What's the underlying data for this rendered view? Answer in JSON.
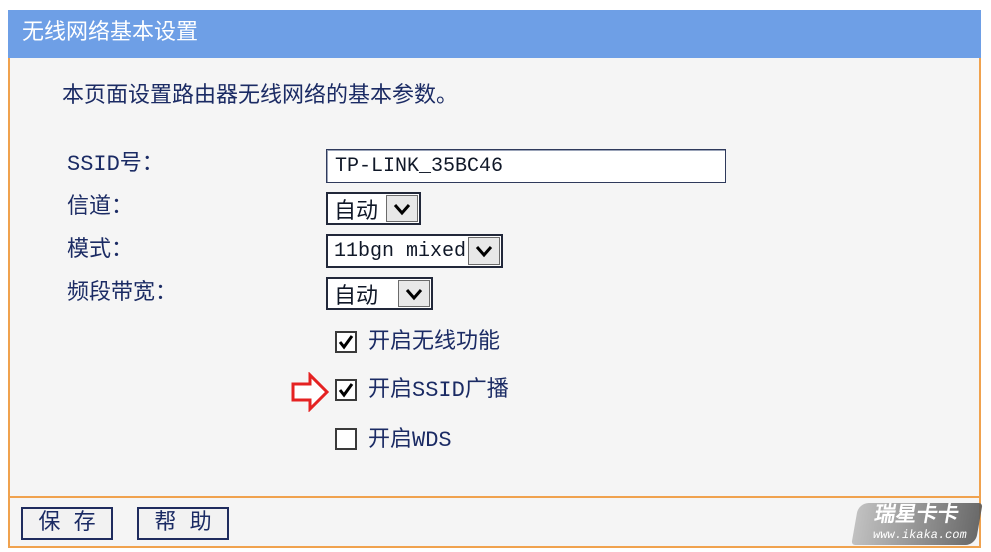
{
  "header": {
    "title": "无线网络基本设置"
  },
  "description": "本页面设置路由器无线网络的基本参数。",
  "form": {
    "ssid": {
      "label": "SSID号：",
      "value": "TP-LINK_35BC46"
    },
    "channel": {
      "label": "信道：",
      "selected": "自动"
    },
    "mode": {
      "label": "模式：",
      "selected": "11bgn mixed"
    },
    "bandwidth": {
      "label": "频段带宽：",
      "selected": "自动"
    },
    "checkboxes": [
      {
        "label": "开启无线功能",
        "checked": true
      },
      {
        "label": "开启SSID广播",
        "checked": true
      },
      {
        "label": "开启WDS",
        "checked": false
      }
    ]
  },
  "footer": {
    "save_label": "保 存",
    "help_label": "帮 助"
  },
  "watermark": {
    "brand": "瑞星卡卡",
    "url": "www.ikaka.com"
  },
  "colors": {
    "header_background": "#6e9fe6",
    "panel_border": "#f0a24e",
    "text": "#1b2b64",
    "annotation_arrow": "#e52222"
  },
  "icons": {
    "dropdown": "chevron-down-icon",
    "checkbox_mark": "checkmark-icon",
    "annotation": "red-arrow-icon"
  }
}
